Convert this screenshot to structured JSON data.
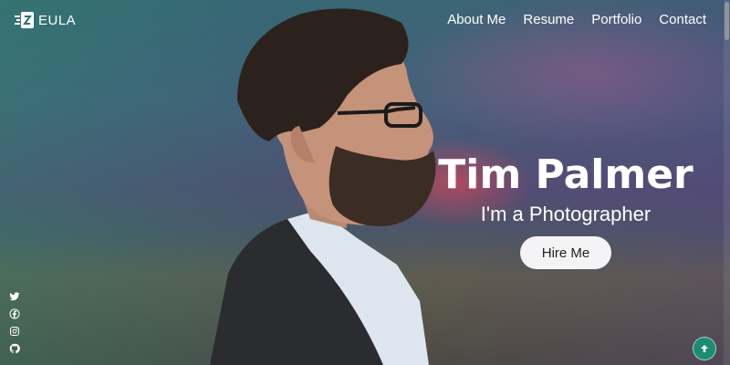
{
  "brand": {
    "name": "EULA",
    "icon": "brand-logo-icon"
  },
  "nav": {
    "items": [
      {
        "label": "About Me"
      },
      {
        "label": "Resume"
      },
      {
        "label": "Portfolio"
      },
      {
        "label": "Contact"
      }
    ]
  },
  "hero": {
    "name": "Tim Palmer",
    "role": "I'm a Photographer",
    "cta_label": "Hire Me"
  },
  "social": {
    "icons": [
      "twitter-icon",
      "facebook-icon",
      "instagram-icon",
      "github-icon"
    ]
  },
  "back_to_top": {
    "icon": "arrow-up-icon"
  },
  "colors": {
    "accent": "#1d8a72",
    "button_bg": "#f4f4f6",
    "button_text": "#222222",
    "text": "#ffffff"
  }
}
